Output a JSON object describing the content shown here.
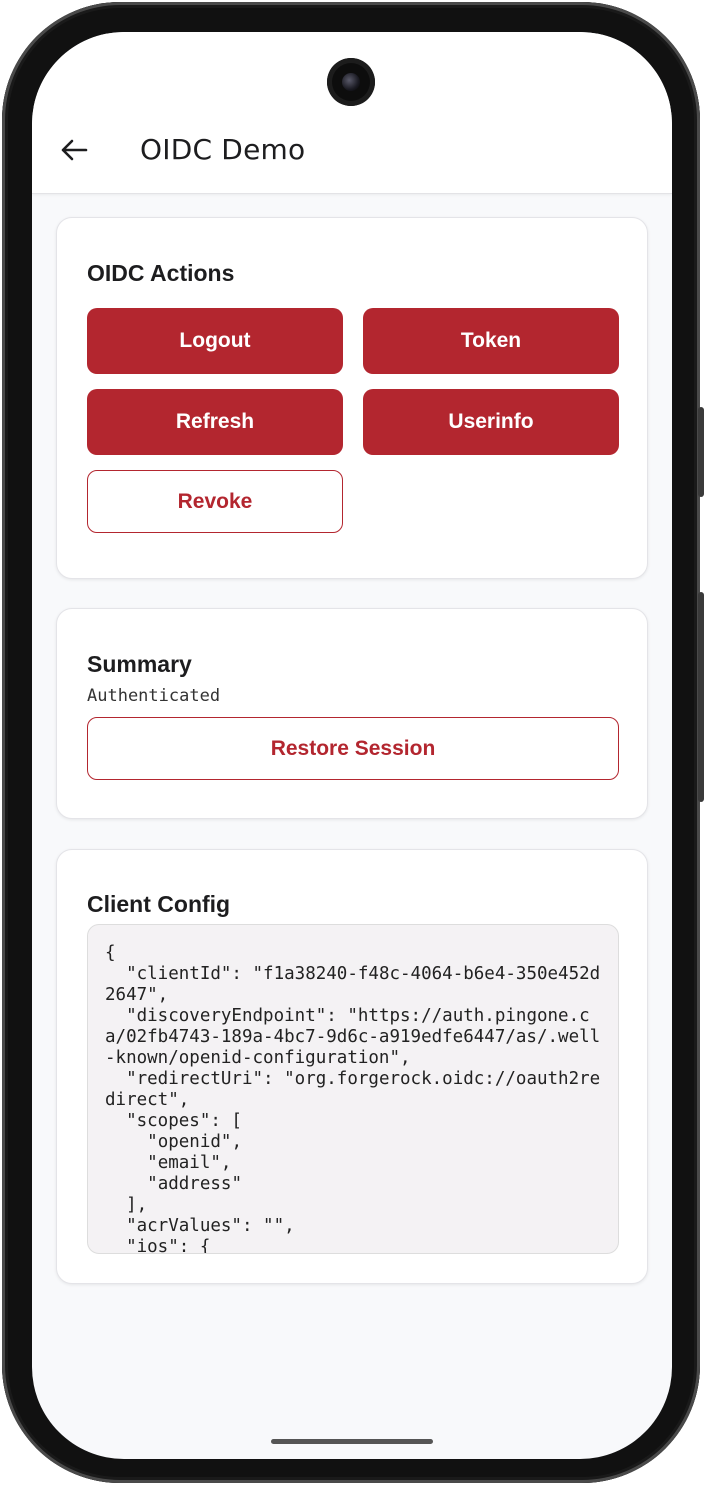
{
  "app_bar": {
    "back_icon": "arrow-left-icon",
    "title": "OIDC Demo"
  },
  "actions_card": {
    "title": "OIDC Actions",
    "buttons": {
      "logout": "Logout",
      "token": "Token",
      "refresh": "Refresh",
      "userinfo": "Userinfo",
      "revoke": "Revoke"
    }
  },
  "summary_card": {
    "title": "Summary",
    "status": "Authenticated",
    "restore_button": "Restore Session"
  },
  "config_card": {
    "title": "Client Config",
    "config_text": "{\n  \"clientId\": \"f1a38240-f48c-4064-b6e4-350e452d2647\",\n  \"discoveryEndpoint\": \"https://auth.pingone.ca/02fb4743-189a-4bc7-9d6c-a919edfe6447/as/.well-known/openid-configuration\",\n  \"redirectUri\": \"org.forgerock.oidc://oauth2redirect\",\n  \"scopes\": [\n    \"openid\",\n    \"email\",\n    \"address\"\n  ],\n  \"acrValues\": \"\",\n  \"ios\": {"
  },
  "colors": {
    "primary": "#b3262f",
    "background": "#f8f9fb",
    "card": "#ffffff",
    "code_background": "#f4f2f4"
  }
}
